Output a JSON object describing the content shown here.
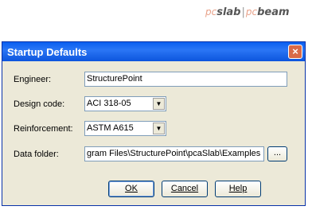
{
  "logo": {
    "pc1": "pc",
    "name1": "slab",
    "sep": "|",
    "pc2": "pc",
    "name2": "beam"
  },
  "dialog": {
    "title": "Startup Defaults",
    "close_glyph": "×"
  },
  "fields": {
    "engineer": {
      "label": "Engineer:",
      "value": "StructurePoint"
    },
    "design_code": {
      "label": "Design code:",
      "value": "ACI 318-05"
    },
    "reinforcement": {
      "label": "Reinforcement:",
      "value": "ASTM A615"
    },
    "data_folder": {
      "label": "Data folder:",
      "value": "gram Files\\StructurePoint\\pcaSlab\\Examples",
      "browse_label": "..."
    }
  },
  "buttons": {
    "ok": "OK",
    "cancel": "Cancel",
    "help": "Help"
  },
  "icons": {
    "close": "close-icon",
    "dropdown": "chevron-down-icon"
  },
  "colors": {
    "titlebar": "#0a5ff0",
    "dialog_bg": "#ece9d8",
    "close_button": "#d96a48",
    "field_border": "#7f9db9"
  }
}
